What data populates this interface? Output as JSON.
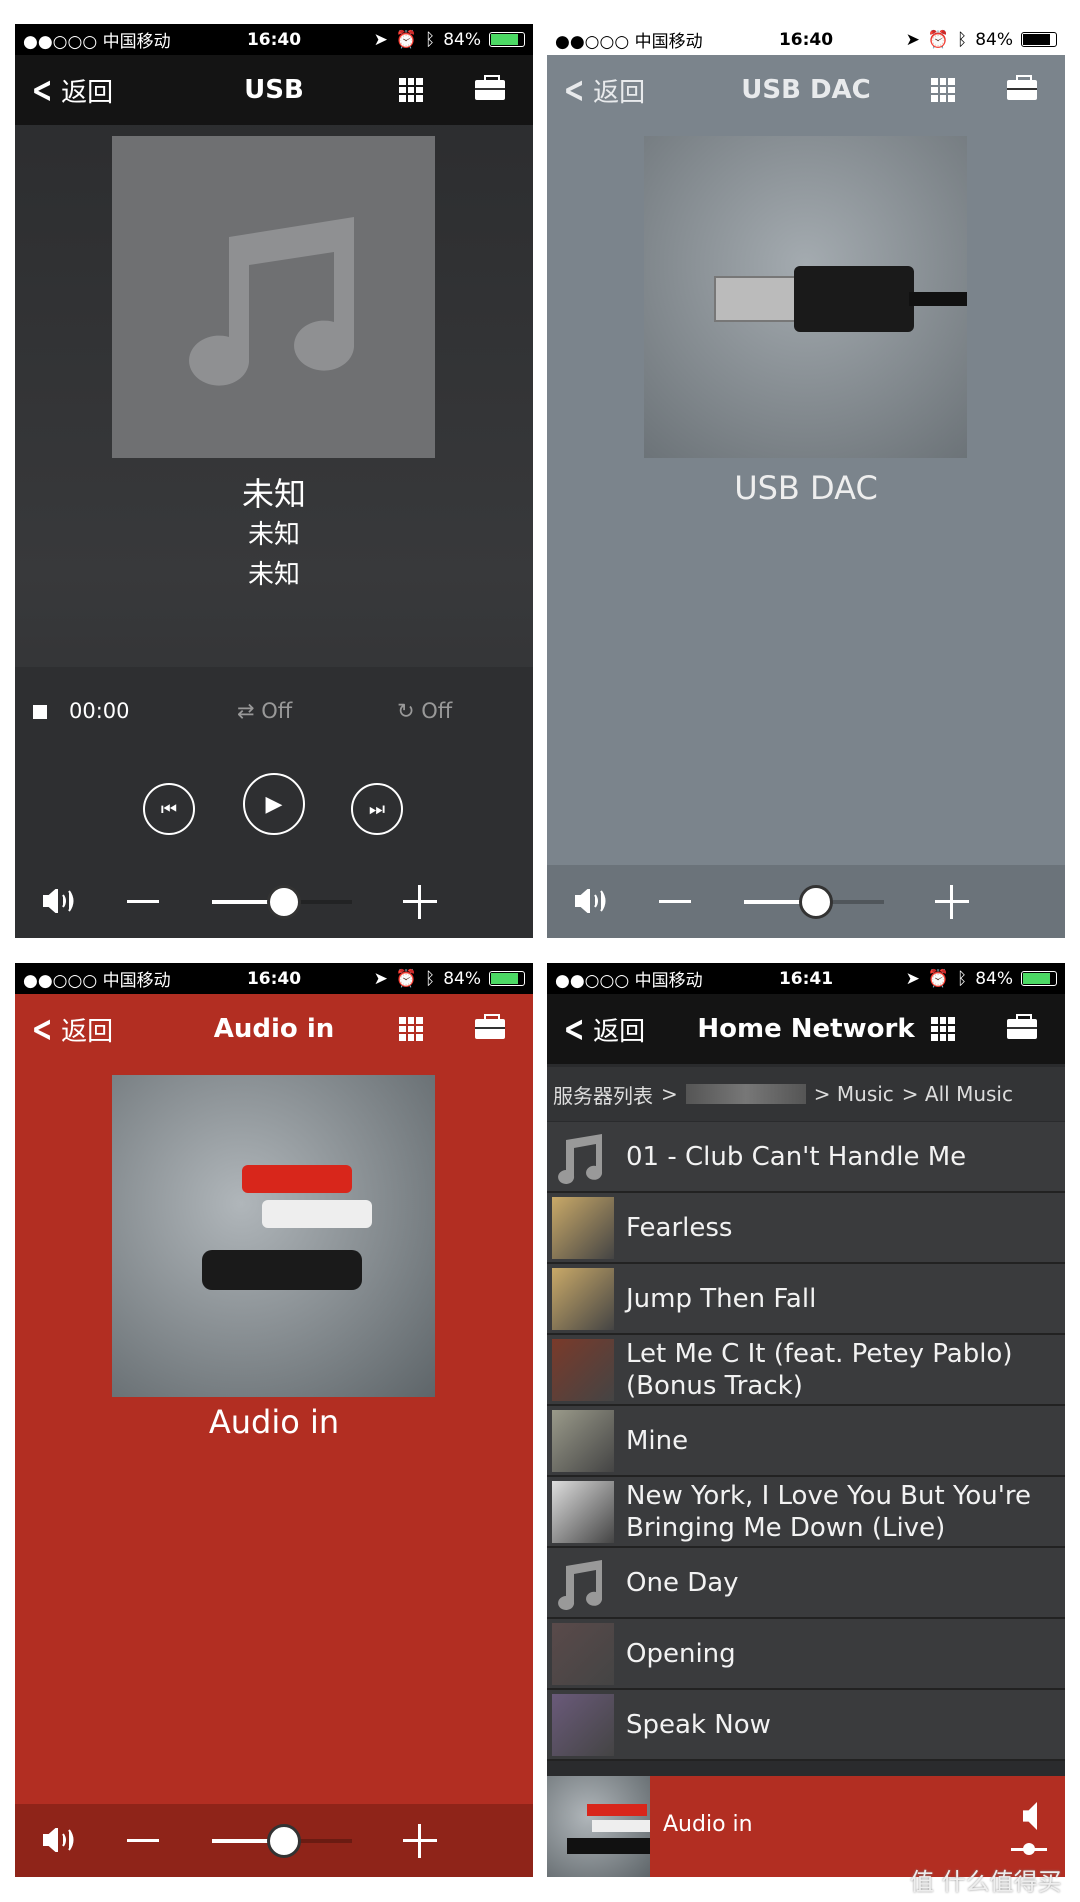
{
  "status": {
    "carrier": "●●○○○ 中国移动",
    "time_a": "16:40",
    "time_b": "16:41",
    "battery": "84%",
    "battery_level": 84
  },
  "nav": {
    "back": "返回"
  },
  "usb": {
    "title": "USB",
    "track": "未知",
    "artist": "未知",
    "album": "未知",
    "time": "00:00",
    "shuffle": "Off",
    "repeat": "Off",
    "volume": 0.5
  },
  "usbdac": {
    "title": "USB DAC",
    "label": "USB DAC",
    "volume": 0.5
  },
  "audioin": {
    "title": "Audio in",
    "label": "Audio in",
    "volume": 0.5
  },
  "network": {
    "title": "Home Network",
    "breadcrumb": [
      "服务器列表",
      ">",
      "> Music",
      "> All Music"
    ],
    "tracks": [
      {
        "title": "01 - Club Can't Handle Me",
        "thumb": "music-note"
      },
      {
        "title": "Fearless",
        "thumb": "album-art"
      },
      {
        "title": "Jump Then Fall",
        "thumb": "album-art"
      },
      {
        "title": "Let Me C It (feat. Petey Pablo) (Bonus Track)",
        "thumb": "album-art"
      },
      {
        "title": "Mine",
        "thumb": "album-art"
      },
      {
        "title": "New York, I Love You But You're Bringing Me Down (Live)",
        "thumb": "album-art"
      },
      {
        "title": "One Day",
        "thumb": "music-note"
      },
      {
        "title": "Opening",
        "thumb": "album-art"
      },
      {
        "title": "Speak Now",
        "thumb": "album-art"
      }
    ],
    "now_playing": "Audio in"
  },
  "watermark": "值 什么值得买",
  "colors": {
    "red": "#b22e22",
    "gray": "#7b848c",
    "dark": "#2a2b2d",
    "battery": "#4cd964"
  }
}
